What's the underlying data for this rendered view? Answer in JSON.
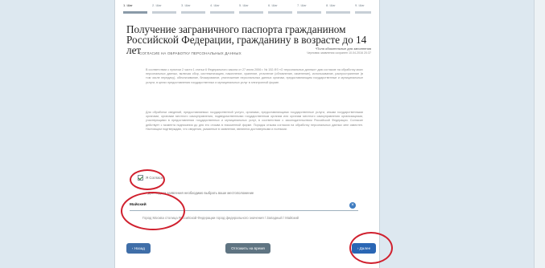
{
  "steps": [
    "1. Шаг",
    "2. Шаг",
    "3. Шаг",
    "4. Шаг",
    "5. Шаг",
    "6. Шаг",
    "7. Шаг",
    "8. Шаг",
    "9. Шаг"
  ],
  "title": "Получение заграничного паспорта гражданином Российской Федерации, гражданину в возрасте до 14 лет",
  "required_note": "*Поля обязательные для заполнения",
  "autosave": "Черновик заявления сохранен 10.04.2016 20:37",
  "section_head": "СОГЛАСИЕ НА ОБРАБОТКУ ПЕРСОНАЛЬНЫХ ДАННЫХ",
  "para1": "В соответствии с пунктом 2 части 1 статьи 6 Федерального закона от 27 июля 2006 г. № 152-ФЗ «О персональных данных» даю согласие на обработку моих персональных данных, включая сбор, систематизацию, накопление, хранение, уточнение (обновление, изменение), использование, распространение (в том числе передачу), обезличивание, блокирование, уничтожение персональных данных органам, предоставляющим государственные и муниципальные услуги, в целях предоставления государственных и муниципальных услуг в электронной форме.",
  "para2": "Для обработки сведений, предоставляемых государственной услуги, органами, предоставляющими государственные услуги, иными государственными органами, органами местного самоуправления, подведомственными государственным органам или органам местного самоуправления организациями, участвующими в предоставлении государственных и муниципальных услуг, в соответствии с законодательством Российской Федерации. Согласие действует с момента подписания до дня его отзыва в письменной форме. Порядок отзыва согласия на обработку персональных данных мне известен. Настоящим подтверждаю, что сведения, указанные в заявлении, являются достоверными и полными.",
  "agree_label": "Я Согласен",
  "location_label": "* Для подачи заявления необходимо выбрать ваше местоположение",
  "location_value": "Майский",
  "location_path": "Город Москва столица Российской Федерации город федерального значения / Западный / Майский",
  "buttons": {
    "back": "‹ Назад",
    "save": "Отложить на время",
    "next": "› Далее"
  },
  "colors": {
    "accent": "#2a66b4",
    "annotation": "#d0202e"
  }
}
